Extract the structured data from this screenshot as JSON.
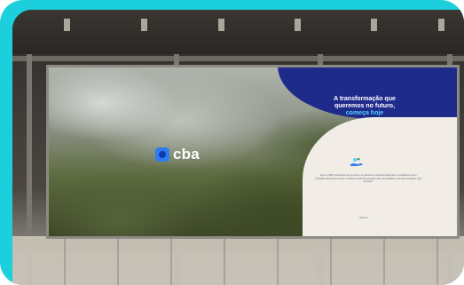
{
  "billboard": {
    "brand": "cba",
    "headline_line1": "A transformação que",
    "headline_line2": "queremos no futuro,",
    "headline_accent": "começa hoje",
    "body": "Aqui na CBA, pensamos nas pessoas e no planeta de maneira sustentável. Acreditamos que a inovação transforma o futuro e melhora a vida das pessoas, das comunidades e do meio ambiente, hoje e sempre.",
    "fine_print": "cba.com"
  },
  "colors": {
    "frame": "#1ccfdc",
    "brand_blue": "#1f2b8a",
    "accent": "#53d4ff"
  },
  "icons": [
    "logo-mark-icon",
    "hand-icon"
  ]
}
